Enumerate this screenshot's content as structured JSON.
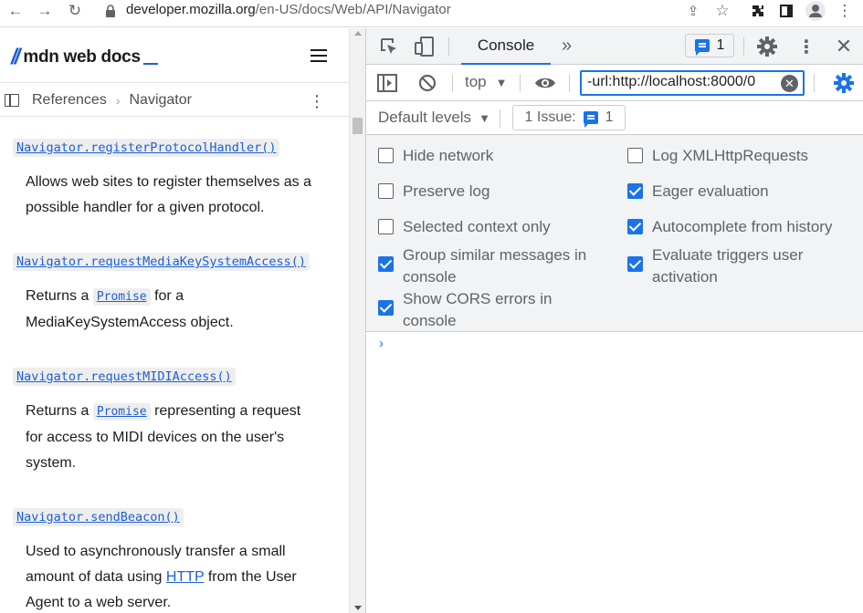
{
  "browser": {
    "url_host": "developer.mozilla.org",
    "url_path": "/en-US/docs/Web/API/Navigator"
  },
  "mdn": {
    "logo_text": "mdn web docs",
    "breadcrumbs": [
      "References",
      "Navigator"
    ],
    "entries": [
      {
        "api": "Navigator.registerProtocolHandler()",
        "desc_lines": [
          "Allows web sites to register themselves as a",
          "possible handler for a given protocol."
        ]
      },
      {
        "api": "Navigator.requestMediaKeySystemAccess()",
        "desc_pre": "Returns a",
        "desc_link": "Promise",
        "desc_post": "for a",
        "desc_line2": "MediaKeySystemAccess object."
      },
      {
        "api": "Navigator.requestMIDIAccess()",
        "desc_pre": "Returns a",
        "desc_link": "Promise",
        "desc_post": "representing a request",
        "desc_line2": "for access to MIDI devices on the user's",
        "desc_line3": "system."
      },
      {
        "api": "Navigator.sendBeacon()",
        "desc_line1": "Used to asynchronously transfer a small",
        "desc_pre2": "amount of data using",
        "desc_link2": "HTTP",
        "desc_post2": "from the User",
        "desc_line3": "Agent to a web server."
      }
    ]
  },
  "devtools": {
    "tabs": {
      "active": "Console"
    },
    "issues_badge": "1",
    "toolbar": {
      "context": "top",
      "filter_value": "-url:http://localhost:8000/0"
    },
    "levels": {
      "label": "Default levels",
      "issue_count_label": "1 Issue:",
      "issue_count": "1"
    },
    "settings": {
      "left": [
        {
          "label": "Hide network",
          "checked": false
        },
        {
          "label": "Preserve log",
          "checked": false
        },
        {
          "label": "Selected context only",
          "checked": false
        },
        {
          "label_line1": "Group similar messages in",
          "label_line2": "console",
          "checked": true
        },
        {
          "label_line1": "Show CORS errors in",
          "label_line2": "console",
          "checked": true
        }
      ],
      "right": [
        {
          "label": "Log XMLHttpRequests",
          "checked": false
        },
        {
          "label": "Eager evaluation",
          "checked": true
        },
        {
          "label": "Autocomplete from history",
          "checked": true
        },
        {
          "label_line1": "Evaluate triggers user",
          "label_line2": "activation",
          "checked": true
        }
      ]
    },
    "accent_color": "#1a73e8"
  }
}
